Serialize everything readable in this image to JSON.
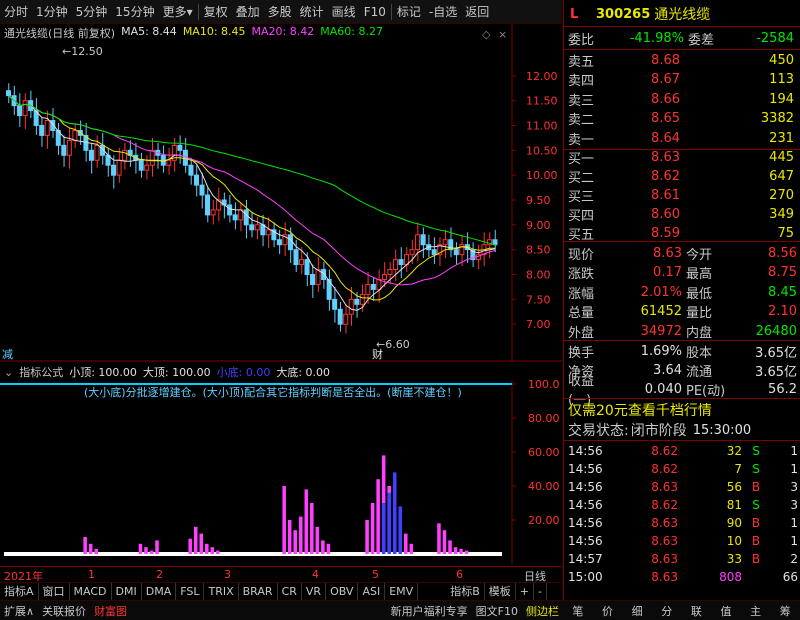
{
  "toolbar": {
    "items": [
      "分时",
      "1分钟",
      "5分钟",
      "15分钟",
      "更多",
      "复权",
      "叠加",
      "多股",
      "统计",
      "画线",
      "F10",
      "标记",
      "-自选",
      "返回"
    ]
  },
  "chart": {
    "name": "通光线缆(日线 前复权)",
    "ma5": "MA5: 8.44",
    "ma10": "MA10: 8.45",
    "ma20": "MA20: 8.42",
    "ma60": "MA60: 8.27",
    "high_label": "12.50",
    "low_label": "6.60",
    "tag_left": "减",
    "tag_low": "财",
    "y_ticks": [
      "12.00",
      "11.50",
      "11.00",
      "10.50",
      "10.00",
      "9.50",
      "9.00",
      "8.50",
      "8.00",
      "7.50",
      "7.00"
    ]
  },
  "indicator": {
    "formula": "指标公式",
    "xiaoding": "小顶: 100.00",
    "dading": "大顶: 100.00",
    "xiaodi": "小底: 0.00",
    "dadi": "大底: 0.00",
    "note": "(大小底)分批逐增建仓。(大小顶)配合其它指标判断是否全出。(断崖不建仓！)",
    "y_ticks": [
      "100.0",
      "80.00",
      "60.00",
      "40.00",
      "20.00"
    ]
  },
  "xaxis": {
    "labels": [
      "2021年",
      "1",
      "2",
      "3",
      "4",
      "5",
      "6"
    ],
    "period": "日线"
  },
  "bottom_tabs": [
    "指标A",
    "窗口",
    "MACD",
    "DMI",
    "DMA",
    "FSL",
    "TRIX",
    "BRAR",
    "CR",
    "VR",
    "OBV",
    "ASI",
    "EMV",
    "指标B",
    "模板",
    "+",
    "-"
  ],
  "status_bar": {
    "left": [
      "扩展∧",
      "关联报价",
      "财富图"
    ],
    "middle": [
      "新用户福利专享",
      "图文F10",
      "侧边栏"
    ],
    "right": [
      "笔",
      "价",
      "细",
      "分",
      "联",
      "值",
      "主",
      "筹"
    ]
  },
  "stock": {
    "tag": "L",
    "code": "300265",
    "name": "通光线缆",
    "weibi_label": "委比",
    "weibi": "-41.98%",
    "weicha_label": "委差",
    "weicha": "-2584",
    "asks": [
      {
        "label": "卖五",
        "price": "8.68",
        "vol": "450"
      },
      {
        "label": "卖四",
        "price": "8.67",
        "vol": "113"
      },
      {
        "label": "卖三",
        "price": "8.66",
        "vol": "194"
      },
      {
        "label": "卖二",
        "price": "8.65",
        "vol": "3382"
      },
      {
        "label": "卖一",
        "price": "8.64",
        "vol": "231"
      }
    ],
    "bids": [
      {
        "label": "买一",
        "price": "8.63",
        "vol": "445"
      },
      {
        "label": "买二",
        "price": "8.62",
        "vol": "647"
      },
      {
        "label": "买三",
        "price": "8.61",
        "vol": "270"
      },
      {
        "label": "买四",
        "price": "8.60",
        "vol": "349"
      },
      {
        "label": "买五",
        "price": "8.59",
        "vol": "75"
      }
    ],
    "quote": [
      {
        "l1": "现价",
        "v1": "8.63",
        "c1": "red",
        "l2": "今开",
        "v2": "8.56",
        "c2": "red"
      },
      {
        "l1": "涨跌",
        "v1": "0.17",
        "c1": "red",
        "l2": "最高",
        "v2": "8.75",
        "c2": "red"
      },
      {
        "l1": "涨幅",
        "v1": "2.01%",
        "c1": "red",
        "l2": "最低",
        "v2": "8.45",
        "c2": "green"
      },
      {
        "l1": "总量",
        "v1": "61452",
        "c1": "yellow",
        "l2": "量比",
        "v2": "2.10",
        "c2": "red"
      },
      {
        "l1": "外盘",
        "v1": "34972",
        "c1": "red",
        "l2": "内盘",
        "v2": "26480",
        "c2": "green"
      }
    ],
    "fund": [
      {
        "l1": "换手",
        "v1": "1.69%",
        "l2": "股本",
        "v2": "3.65亿"
      },
      {
        "l1": "净资",
        "v1": "3.64",
        "l2": "流通",
        "v2": "3.65亿"
      },
      {
        "l1": "收益(一)",
        "v1": "0.040",
        "l2": "PE(动)",
        "v2": "56.2"
      }
    ],
    "promo": "仅需20元查看千档行情",
    "trade_state_label": "交易状态:",
    "trade_state": "闭市阶段",
    "trade_time": "15:30:00",
    "ticks": [
      {
        "t": "14:56",
        "p": "8.62",
        "v": "32",
        "s": "S",
        "n": "1"
      },
      {
        "t": "14:56",
        "p": "8.62",
        "v": "7",
        "s": "S",
        "n": "1"
      },
      {
        "t": "14:56",
        "p": "8.63",
        "v": "56",
        "s": "B",
        "n": "3"
      },
      {
        "t": "14:56",
        "p": "8.62",
        "v": "81",
        "s": "S",
        "n": "3"
      },
      {
        "t": "14:56",
        "p": "8.63",
        "v": "90",
        "s": "B",
        "n": "1"
      },
      {
        "t": "14:56",
        "p": "8.63",
        "v": "10",
        "s": "B",
        "n": "1"
      },
      {
        "t": "14:57",
        "p": "8.63",
        "v": "33",
        "s": "B",
        "n": "2"
      },
      {
        "t": "15:00",
        "p": "8.63",
        "v": "808",
        "s": "",
        "n": "66"
      }
    ]
  },
  "colors": {
    "ma5": "#e0e0e0",
    "ma10": "#e8e800",
    "ma20": "#ff40ff",
    "ma60": "#00e600",
    "up": "#ff3232",
    "down": "#60d0ff",
    "bar": "#ff40ff",
    "bar_blue": "#4040ff"
  }
}
